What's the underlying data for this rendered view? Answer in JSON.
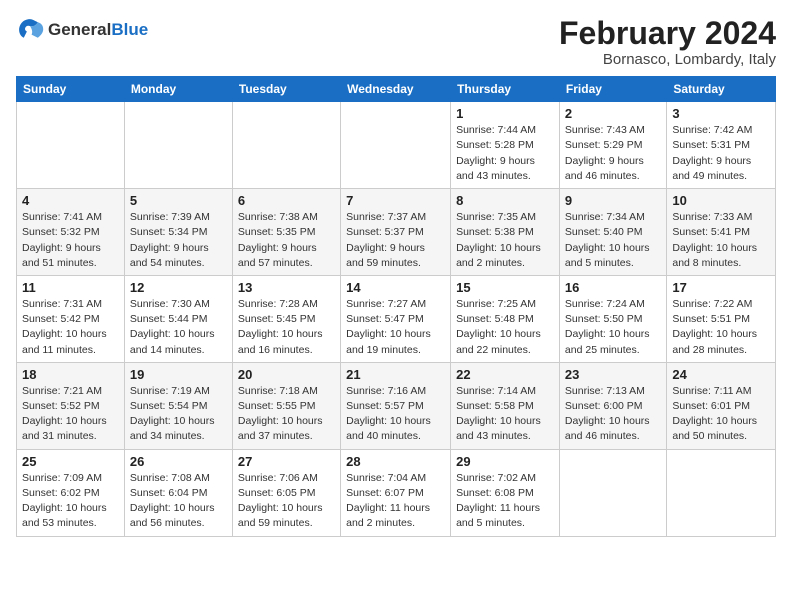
{
  "header": {
    "logo_general": "General",
    "logo_blue": "Blue",
    "month_title": "February 2024",
    "location": "Bornasco, Lombardy, Italy"
  },
  "days_of_week": [
    "Sunday",
    "Monday",
    "Tuesday",
    "Wednesday",
    "Thursday",
    "Friday",
    "Saturday"
  ],
  "weeks": [
    [
      {
        "day": "",
        "info": ""
      },
      {
        "day": "",
        "info": ""
      },
      {
        "day": "",
        "info": ""
      },
      {
        "day": "",
        "info": ""
      },
      {
        "day": "1",
        "info": "Sunrise: 7:44 AM\nSunset: 5:28 PM\nDaylight: 9 hours\nand 43 minutes."
      },
      {
        "day": "2",
        "info": "Sunrise: 7:43 AM\nSunset: 5:29 PM\nDaylight: 9 hours\nand 46 minutes."
      },
      {
        "day": "3",
        "info": "Sunrise: 7:42 AM\nSunset: 5:31 PM\nDaylight: 9 hours\nand 49 minutes."
      }
    ],
    [
      {
        "day": "4",
        "info": "Sunrise: 7:41 AM\nSunset: 5:32 PM\nDaylight: 9 hours\nand 51 minutes."
      },
      {
        "day": "5",
        "info": "Sunrise: 7:39 AM\nSunset: 5:34 PM\nDaylight: 9 hours\nand 54 minutes."
      },
      {
        "day": "6",
        "info": "Sunrise: 7:38 AM\nSunset: 5:35 PM\nDaylight: 9 hours\nand 57 minutes."
      },
      {
        "day": "7",
        "info": "Sunrise: 7:37 AM\nSunset: 5:37 PM\nDaylight: 9 hours\nand 59 minutes."
      },
      {
        "day": "8",
        "info": "Sunrise: 7:35 AM\nSunset: 5:38 PM\nDaylight: 10 hours\nand 2 minutes."
      },
      {
        "day": "9",
        "info": "Sunrise: 7:34 AM\nSunset: 5:40 PM\nDaylight: 10 hours\nand 5 minutes."
      },
      {
        "day": "10",
        "info": "Sunrise: 7:33 AM\nSunset: 5:41 PM\nDaylight: 10 hours\nand 8 minutes."
      }
    ],
    [
      {
        "day": "11",
        "info": "Sunrise: 7:31 AM\nSunset: 5:42 PM\nDaylight: 10 hours\nand 11 minutes."
      },
      {
        "day": "12",
        "info": "Sunrise: 7:30 AM\nSunset: 5:44 PM\nDaylight: 10 hours\nand 14 minutes."
      },
      {
        "day": "13",
        "info": "Sunrise: 7:28 AM\nSunset: 5:45 PM\nDaylight: 10 hours\nand 16 minutes."
      },
      {
        "day": "14",
        "info": "Sunrise: 7:27 AM\nSunset: 5:47 PM\nDaylight: 10 hours\nand 19 minutes."
      },
      {
        "day": "15",
        "info": "Sunrise: 7:25 AM\nSunset: 5:48 PM\nDaylight: 10 hours\nand 22 minutes."
      },
      {
        "day": "16",
        "info": "Sunrise: 7:24 AM\nSunset: 5:50 PM\nDaylight: 10 hours\nand 25 minutes."
      },
      {
        "day": "17",
        "info": "Sunrise: 7:22 AM\nSunset: 5:51 PM\nDaylight: 10 hours\nand 28 minutes."
      }
    ],
    [
      {
        "day": "18",
        "info": "Sunrise: 7:21 AM\nSunset: 5:52 PM\nDaylight: 10 hours\nand 31 minutes."
      },
      {
        "day": "19",
        "info": "Sunrise: 7:19 AM\nSunset: 5:54 PM\nDaylight: 10 hours\nand 34 minutes."
      },
      {
        "day": "20",
        "info": "Sunrise: 7:18 AM\nSunset: 5:55 PM\nDaylight: 10 hours\nand 37 minutes."
      },
      {
        "day": "21",
        "info": "Sunrise: 7:16 AM\nSunset: 5:57 PM\nDaylight: 10 hours\nand 40 minutes."
      },
      {
        "day": "22",
        "info": "Sunrise: 7:14 AM\nSunset: 5:58 PM\nDaylight: 10 hours\nand 43 minutes."
      },
      {
        "day": "23",
        "info": "Sunrise: 7:13 AM\nSunset: 6:00 PM\nDaylight: 10 hours\nand 46 minutes."
      },
      {
        "day": "24",
        "info": "Sunrise: 7:11 AM\nSunset: 6:01 PM\nDaylight: 10 hours\nand 50 minutes."
      }
    ],
    [
      {
        "day": "25",
        "info": "Sunrise: 7:09 AM\nSunset: 6:02 PM\nDaylight: 10 hours\nand 53 minutes."
      },
      {
        "day": "26",
        "info": "Sunrise: 7:08 AM\nSunset: 6:04 PM\nDaylight: 10 hours\nand 56 minutes."
      },
      {
        "day": "27",
        "info": "Sunrise: 7:06 AM\nSunset: 6:05 PM\nDaylight: 10 hours\nand 59 minutes."
      },
      {
        "day": "28",
        "info": "Sunrise: 7:04 AM\nSunset: 6:07 PM\nDaylight: 11 hours\nand 2 minutes."
      },
      {
        "day": "29",
        "info": "Sunrise: 7:02 AM\nSunset: 6:08 PM\nDaylight: 11 hours\nand 5 minutes."
      },
      {
        "day": "",
        "info": ""
      },
      {
        "day": "",
        "info": ""
      }
    ]
  ]
}
